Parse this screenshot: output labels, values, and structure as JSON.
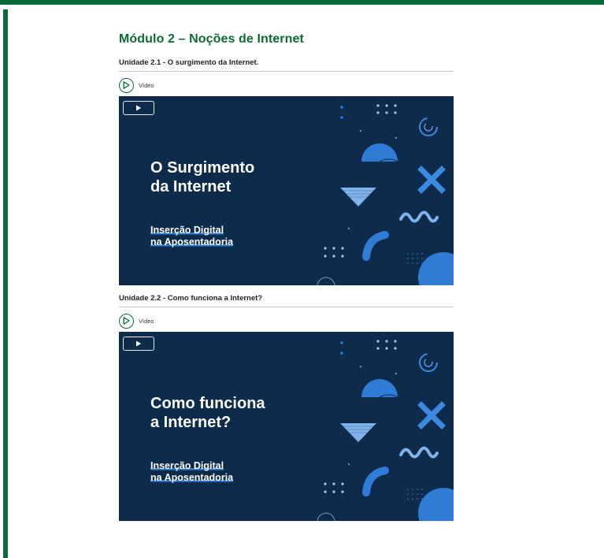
{
  "module": {
    "title": "Módulo 2 – Noções de Internet"
  },
  "units": [
    {
      "title": "Unidade 2.1 - O surgimento da Internet.",
      "video_label": "Vídeo",
      "slide_title": "O Surgimento\nda Internet",
      "slide_subtitle_line1": "Inserção Digital",
      "slide_subtitle_line2": "na Aposentadoria"
    },
    {
      "title": "Unidade 2.2 - Como funciona a Internet?",
      "video_label": "Vídeo",
      "slide_title": "Como funciona\na Internet?",
      "slide_subtitle_line1": "Inserção Digital",
      "slide_subtitle_line2": "na Aposentadoria"
    }
  ],
  "colors": {
    "brand_green": "#0b6b34",
    "slide_background": "#0e2b4b",
    "accent_blue": "#2e7cd6"
  }
}
